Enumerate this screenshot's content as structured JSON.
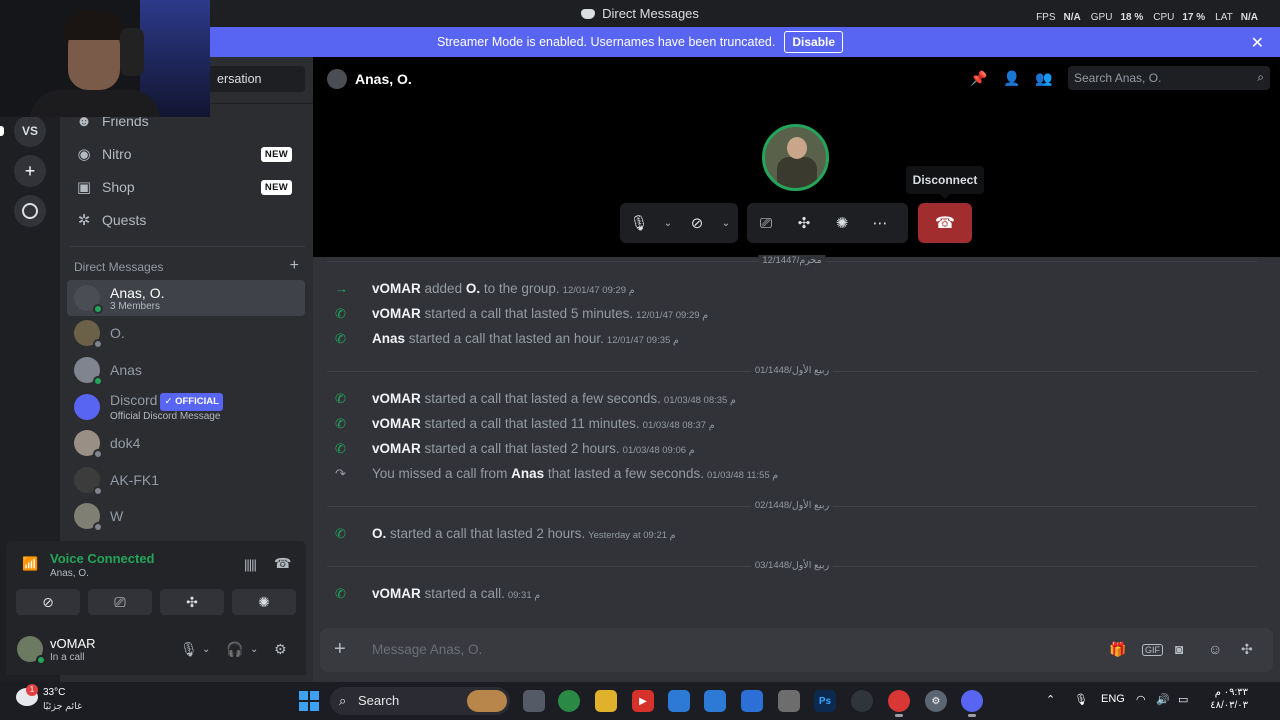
{
  "titlebar": {
    "title": "Direct Messages",
    "perf": [
      {
        "label": "FPS",
        "value": "N/A"
      },
      {
        "label": "GPU",
        "value": "18 %"
      },
      {
        "label": "CPU",
        "value": "17 %"
      },
      {
        "label": "LAT",
        "value": "N/A"
      }
    ]
  },
  "banner": {
    "text": "Streamer Mode is enabled. Usernames have been truncated.",
    "button": "Disable"
  },
  "rail": {
    "selected_server": "VS"
  },
  "sidebar": {
    "search_text": "ersation",
    "nav": [
      {
        "label": "Friends",
        "icon": "friends-icon"
      },
      {
        "label": "Nitro",
        "icon": "nitro-icon",
        "badge": "NEW"
      },
      {
        "label": "Shop",
        "icon": "shop-icon",
        "badge": "NEW"
      },
      {
        "label": "Quests",
        "icon": "quests-icon"
      }
    ],
    "dm_header": "Direct Messages",
    "dms": [
      {
        "name": "Anas, O.",
        "sub": "3 Members",
        "status": "online",
        "selected": true,
        "avatar": "#4a4d54"
      },
      {
        "name": "O.",
        "sub": "",
        "status": "offline",
        "avatar": "#6b6148"
      },
      {
        "name": "Anas",
        "sub": "",
        "status": "online",
        "avatar": "#80848e"
      },
      {
        "name": "Discord",
        "badge": "OFFICIAL",
        "sub": "Official Discord Message",
        "status": "none",
        "avatar": "#5865f2"
      },
      {
        "name": "dok4",
        "sub": "",
        "status": "offline",
        "avatar": "#9a8f84"
      },
      {
        "name": "AK-FK1",
        "sub": "",
        "status": "offline",
        "avatar": "#3c3c3c"
      },
      {
        "name": "W",
        "sub": "",
        "status": "offline",
        "avatar": "#7f8073"
      }
    ]
  },
  "voice": {
    "status": "Voice Connected",
    "channel": "Anas, O."
  },
  "user": {
    "name": "vOMAR",
    "status": "In a call"
  },
  "header": {
    "name": "Anas, O.",
    "search_placeholder": "Search Anas, O."
  },
  "call": {
    "tooltip": "Disconnect"
  },
  "messages": {
    "dividers": [
      "12/1447/محرم",
      "ربيع الأول/01/1448",
      "ربيع الأول/02/1448",
      "ربيع الأول/03/1448"
    ],
    "items": [
      {
        "icon": "arrow-icon",
        "user": "vOMAR",
        "text": "added",
        "target": "O.",
        "rest": "to the group.",
        "ts": "12/01/47 09:29 م"
      },
      {
        "icon": "call-icon",
        "user": "vOMAR",
        "text": "started a call that lasted 5 minutes.",
        "ts": "12/01/47 09:29 م"
      },
      {
        "icon": "call-icon",
        "user": "Anas",
        "text": "started a call that lasted an hour.",
        "ts": "12/01/47 09:35 م"
      },
      {
        "icon": "call-icon",
        "user": "vOMAR",
        "text": "started a call that lasted a few seconds.",
        "ts": "01/03/48 08:35 م"
      },
      {
        "icon": "call-icon",
        "user": "vOMAR",
        "text": "started a call that lasted 11 minutes.",
        "ts": "01/03/48 08:37 م"
      },
      {
        "icon": "call-icon",
        "user": "vOMAR",
        "text": "started a call that lasted 2 hours.",
        "ts": "01/03/48 09:06 م"
      },
      {
        "icon": "missed-call-icon",
        "pre": "You missed a call from",
        "user": "Anas",
        "text": "that lasted a few seconds.",
        "ts": "01/03/48 11:55 م"
      },
      {
        "icon": "call-icon",
        "user": "O.",
        "text": "started a call that lasted 2 hours.",
        "ts": "Yesterday at 09:21 م"
      },
      {
        "icon": "call-icon",
        "user": "vOMAR",
        "text": "started a call.",
        "ts": "09:31 م"
      }
    ]
  },
  "composer": {
    "placeholder": "Message Anas, O."
  },
  "taskbar": {
    "temp": "33°C",
    "condition": "غائم جزئيًا",
    "weather_badge": "1",
    "search": "Search",
    "lang": "ENG",
    "time": "٠٩:٣٣ م",
    "date": "٤٨/٠٣/٠٣"
  }
}
